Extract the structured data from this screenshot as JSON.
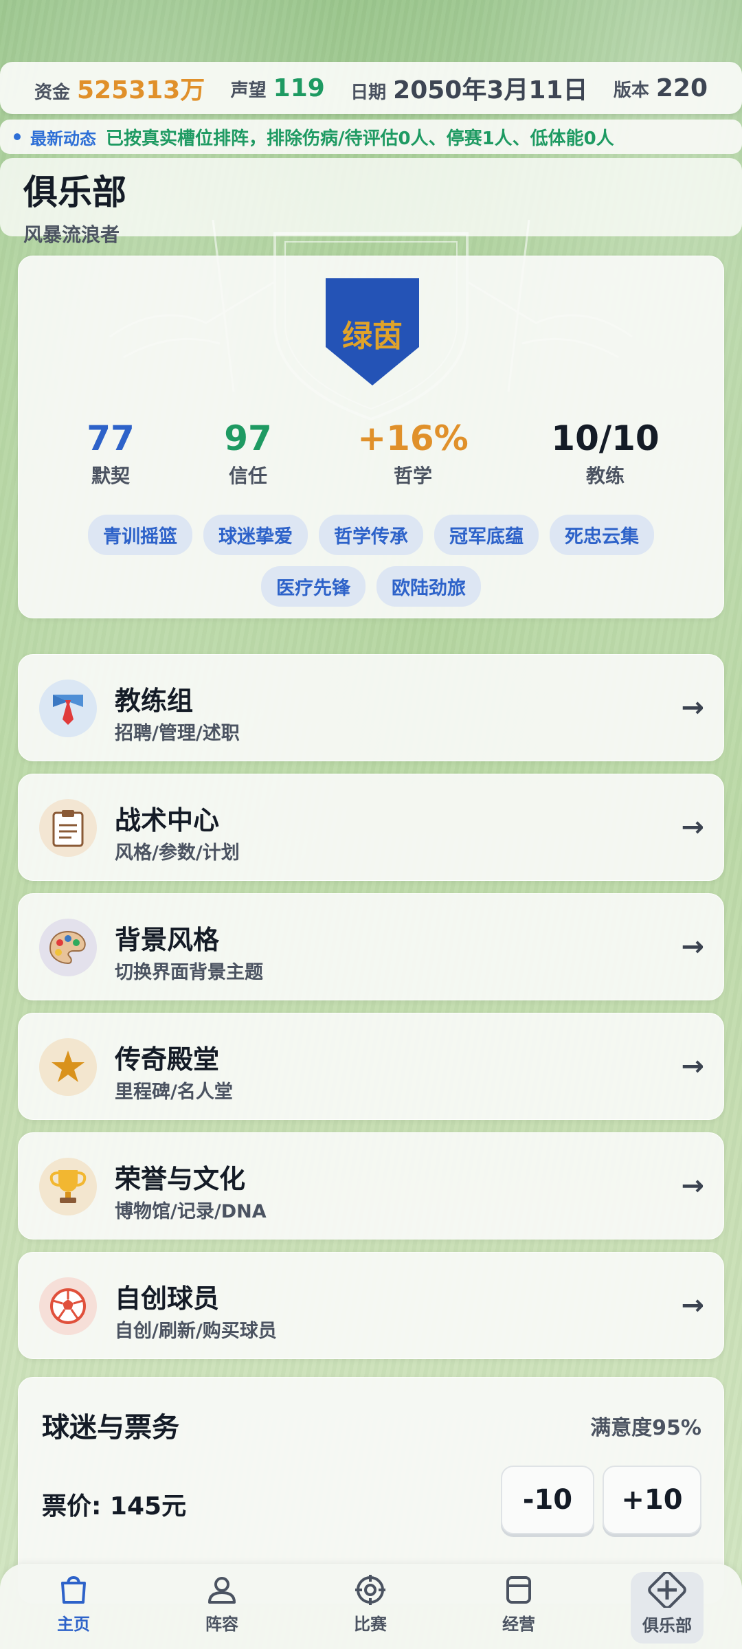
{
  "status": {
    "funds_label": "资金",
    "funds_value": "525313万",
    "funds_color": "#e0902a",
    "rep_label": "声望",
    "rep_value": "119",
    "rep_color": "#1e9a62",
    "date_label": "日期",
    "date_value": "2050年3月11日",
    "ver_label": "版本",
    "ver_value": "220"
  },
  "news": {
    "label": "最新动态",
    "text": "已按真实槽位排阵，排除伤病/待评估0人、停赛1人、低体能0人"
  },
  "club": {
    "title": "俱乐部",
    "subtitle": "风暴流浪者",
    "crest_text": "绿茵",
    "metrics": [
      {
        "value": "77",
        "label": "默契",
        "color": "#2d62c9"
      },
      {
        "value": "97",
        "label": "信任",
        "color": "#1e9a62"
      },
      {
        "value": "+16%",
        "label": "哲学",
        "color": "#e0902a"
      },
      {
        "value": "10/10",
        "label": "教练",
        "color": "#141b26"
      }
    ],
    "tags_row1": [
      "青训摇篮",
      "球迷挚爱",
      "哲学传承",
      "冠军底蕴",
      "死忠云集"
    ],
    "tags_row2": [
      "医疗先锋",
      "欧陆劲旅"
    ]
  },
  "menu": [
    {
      "title": "教练组",
      "subtitle": "招聘/管理/述职",
      "icon": "tie-icon",
      "arrow": "→"
    },
    {
      "title": "战术中心",
      "subtitle": "风格/参数/计划",
      "icon": "clipboard-icon",
      "arrow": "→"
    },
    {
      "title": "背景风格",
      "subtitle": "切换界面背景主题",
      "icon": "palette-icon",
      "arrow": "→"
    },
    {
      "title": "传奇殿堂",
      "subtitle": "里程碑/名人堂",
      "icon": "star-icon",
      "arrow": "→"
    },
    {
      "title": "荣誉与文化",
      "subtitle": "博物馆/记录/DNA",
      "icon": "trophy-icon",
      "arrow": "→"
    },
    {
      "title": "自创球员",
      "subtitle": "自创/刷新/购买球员",
      "icon": "soccer-ball-icon",
      "arrow": "→"
    }
  ],
  "tickets": {
    "title": "球迷与票务",
    "satisfaction": "满意度95%",
    "price": "票价: 145元",
    "minus": "-10",
    "plus": "+10"
  },
  "tabs": [
    {
      "label": "主页",
      "icon": "home-bag-icon",
      "active": true
    },
    {
      "label": "阵容",
      "icon": "person-icon",
      "active": false
    },
    {
      "label": "比赛",
      "icon": "target-icon",
      "active": false
    },
    {
      "label": "经营",
      "icon": "calendar-icon",
      "active": false
    },
    {
      "label": "俱乐部",
      "icon": "club-cross-icon",
      "active": false
    }
  ]
}
